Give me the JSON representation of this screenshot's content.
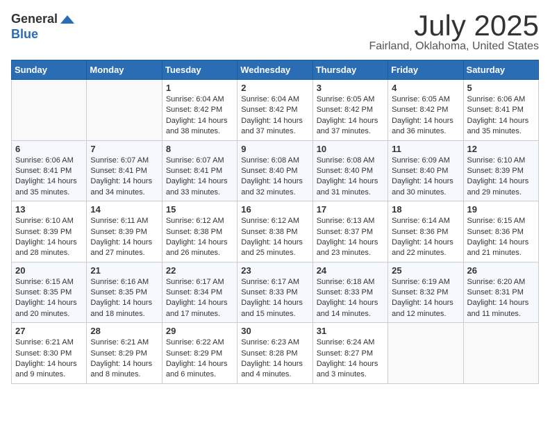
{
  "header": {
    "logo_general": "General",
    "logo_blue": "Blue",
    "month_title": "July 2025",
    "location": "Fairland, Oklahoma, United States"
  },
  "days_of_week": [
    "Sunday",
    "Monday",
    "Tuesday",
    "Wednesday",
    "Thursday",
    "Friday",
    "Saturday"
  ],
  "weeks": [
    [
      {
        "day": "",
        "sunrise": "",
        "sunset": "",
        "daylight": ""
      },
      {
        "day": "",
        "sunrise": "",
        "sunset": "",
        "daylight": ""
      },
      {
        "day": "1",
        "sunrise": "Sunrise: 6:04 AM",
        "sunset": "Sunset: 8:42 PM",
        "daylight": "Daylight: 14 hours and 38 minutes."
      },
      {
        "day": "2",
        "sunrise": "Sunrise: 6:04 AM",
        "sunset": "Sunset: 8:42 PM",
        "daylight": "Daylight: 14 hours and 37 minutes."
      },
      {
        "day": "3",
        "sunrise": "Sunrise: 6:05 AM",
        "sunset": "Sunset: 8:42 PM",
        "daylight": "Daylight: 14 hours and 37 minutes."
      },
      {
        "day": "4",
        "sunrise": "Sunrise: 6:05 AM",
        "sunset": "Sunset: 8:42 PM",
        "daylight": "Daylight: 14 hours and 36 minutes."
      },
      {
        "day": "5",
        "sunrise": "Sunrise: 6:06 AM",
        "sunset": "Sunset: 8:41 PM",
        "daylight": "Daylight: 14 hours and 35 minutes."
      }
    ],
    [
      {
        "day": "6",
        "sunrise": "Sunrise: 6:06 AM",
        "sunset": "Sunset: 8:41 PM",
        "daylight": "Daylight: 14 hours and 35 minutes."
      },
      {
        "day": "7",
        "sunrise": "Sunrise: 6:07 AM",
        "sunset": "Sunset: 8:41 PM",
        "daylight": "Daylight: 14 hours and 34 minutes."
      },
      {
        "day": "8",
        "sunrise": "Sunrise: 6:07 AM",
        "sunset": "Sunset: 8:41 PM",
        "daylight": "Daylight: 14 hours and 33 minutes."
      },
      {
        "day": "9",
        "sunrise": "Sunrise: 6:08 AM",
        "sunset": "Sunset: 8:40 PM",
        "daylight": "Daylight: 14 hours and 32 minutes."
      },
      {
        "day": "10",
        "sunrise": "Sunrise: 6:08 AM",
        "sunset": "Sunset: 8:40 PM",
        "daylight": "Daylight: 14 hours and 31 minutes."
      },
      {
        "day": "11",
        "sunrise": "Sunrise: 6:09 AM",
        "sunset": "Sunset: 8:40 PM",
        "daylight": "Daylight: 14 hours and 30 minutes."
      },
      {
        "day": "12",
        "sunrise": "Sunrise: 6:10 AM",
        "sunset": "Sunset: 8:39 PM",
        "daylight": "Daylight: 14 hours and 29 minutes."
      }
    ],
    [
      {
        "day": "13",
        "sunrise": "Sunrise: 6:10 AM",
        "sunset": "Sunset: 8:39 PM",
        "daylight": "Daylight: 14 hours and 28 minutes."
      },
      {
        "day": "14",
        "sunrise": "Sunrise: 6:11 AM",
        "sunset": "Sunset: 8:39 PM",
        "daylight": "Daylight: 14 hours and 27 minutes."
      },
      {
        "day": "15",
        "sunrise": "Sunrise: 6:12 AM",
        "sunset": "Sunset: 8:38 PM",
        "daylight": "Daylight: 14 hours and 26 minutes."
      },
      {
        "day": "16",
        "sunrise": "Sunrise: 6:12 AM",
        "sunset": "Sunset: 8:38 PM",
        "daylight": "Daylight: 14 hours and 25 minutes."
      },
      {
        "day": "17",
        "sunrise": "Sunrise: 6:13 AM",
        "sunset": "Sunset: 8:37 PM",
        "daylight": "Daylight: 14 hours and 23 minutes."
      },
      {
        "day": "18",
        "sunrise": "Sunrise: 6:14 AM",
        "sunset": "Sunset: 8:36 PM",
        "daylight": "Daylight: 14 hours and 22 minutes."
      },
      {
        "day": "19",
        "sunrise": "Sunrise: 6:15 AM",
        "sunset": "Sunset: 8:36 PM",
        "daylight": "Daylight: 14 hours and 21 minutes."
      }
    ],
    [
      {
        "day": "20",
        "sunrise": "Sunrise: 6:15 AM",
        "sunset": "Sunset: 8:35 PM",
        "daylight": "Daylight: 14 hours and 20 minutes."
      },
      {
        "day": "21",
        "sunrise": "Sunrise: 6:16 AM",
        "sunset": "Sunset: 8:35 PM",
        "daylight": "Daylight: 14 hours and 18 minutes."
      },
      {
        "day": "22",
        "sunrise": "Sunrise: 6:17 AM",
        "sunset": "Sunset: 8:34 PM",
        "daylight": "Daylight: 14 hours and 17 minutes."
      },
      {
        "day": "23",
        "sunrise": "Sunrise: 6:17 AM",
        "sunset": "Sunset: 8:33 PM",
        "daylight": "Daylight: 14 hours and 15 minutes."
      },
      {
        "day": "24",
        "sunrise": "Sunrise: 6:18 AM",
        "sunset": "Sunset: 8:33 PM",
        "daylight": "Daylight: 14 hours and 14 minutes."
      },
      {
        "day": "25",
        "sunrise": "Sunrise: 6:19 AM",
        "sunset": "Sunset: 8:32 PM",
        "daylight": "Daylight: 14 hours and 12 minutes."
      },
      {
        "day": "26",
        "sunrise": "Sunrise: 6:20 AM",
        "sunset": "Sunset: 8:31 PM",
        "daylight": "Daylight: 14 hours and 11 minutes."
      }
    ],
    [
      {
        "day": "27",
        "sunrise": "Sunrise: 6:21 AM",
        "sunset": "Sunset: 8:30 PM",
        "daylight": "Daylight: 14 hours and 9 minutes."
      },
      {
        "day": "28",
        "sunrise": "Sunrise: 6:21 AM",
        "sunset": "Sunset: 8:29 PM",
        "daylight": "Daylight: 14 hours and 8 minutes."
      },
      {
        "day": "29",
        "sunrise": "Sunrise: 6:22 AM",
        "sunset": "Sunset: 8:29 PM",
        "daylight": "Daylight: 14 hours and 6 minutes."
      },
      {
        "day": "30",
        "sunrise": "Sunrise: 6:23 AM",
        "sunset": "Sunset: 8:28 PM",
        "daylight": "Daylight: 14 hours and 4 minutes."
      },
      {
        "day": "31",
        "sunrise": "Sunrise: 6:24 AM",
        "sunset": "Sunset: 8:27 PM",
        "daylight": "Daylight: 14 hours and 3 minutes."
      },
      {
        "day": "",
        "sunrise": "",
        "sunset": "",
        "daylight": ""
      },
      {
        "day": "",
        "sunrise": "",
        "sunset": "",
        "daylight": ""
      }
    ]
  ]
}
